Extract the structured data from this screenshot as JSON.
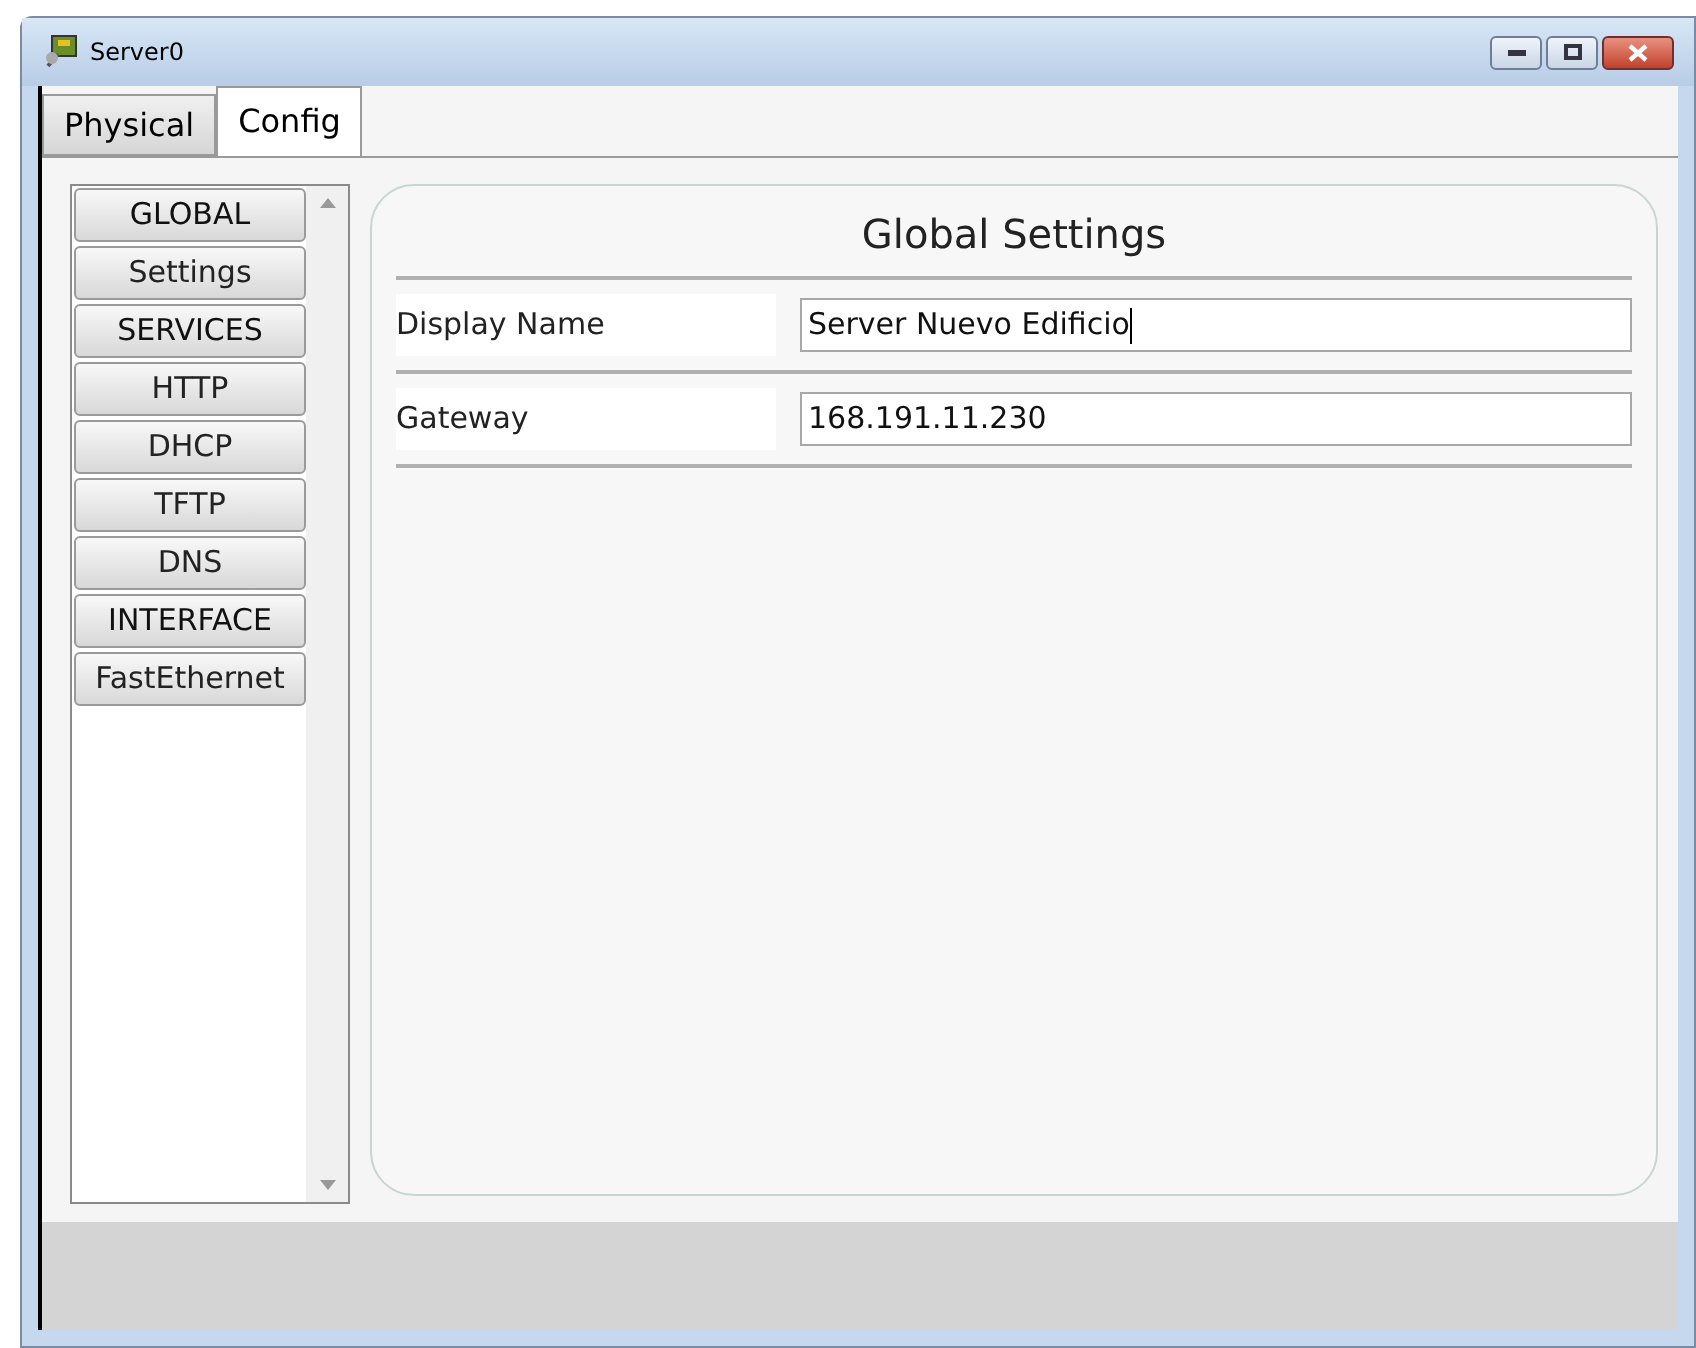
{
  "window": {
    "title": "Server0"
  },
  "tabs": [
    {
      "label": "Physical",
      "selected": false
    },
    {
      "label": "Config",
      "selected": true
    }
  ],
  "sidebar": {
    "items": [
      {
        "label": "GLOBAL",
        "kind": "header"
      },
      {
        "label": "Settings",
        "kind": "item"
      },
      {
        "label": "SERVICES",
        "kind": "header"
      },
      {
        "label": "HTTP",
        "kind": "item"
      },
      {
        "label": "DHCP",
        "kind": "item"
      },
      {
        "label": "TFTP",
        "kind": "item"
      },
      {
        "label": "DNS",
        "kind": "item"
      },
      {
        "label": "INTERFACE",
        "kind": "header"
      },
      {
        "label": "FastEthernet",
        "kind": "item"
      }
    ]
  },
  "panel": {
    "title": "Global Settings",
    "fields": [
      {
        "label": "Display Name",
        "value": "Server Nuevo Edificio",
        "focused": true
      },
      {
        "label": "Gateway",
        "value": "168.191.11.230",
        "focused": false
      }
    ]
  }
}
